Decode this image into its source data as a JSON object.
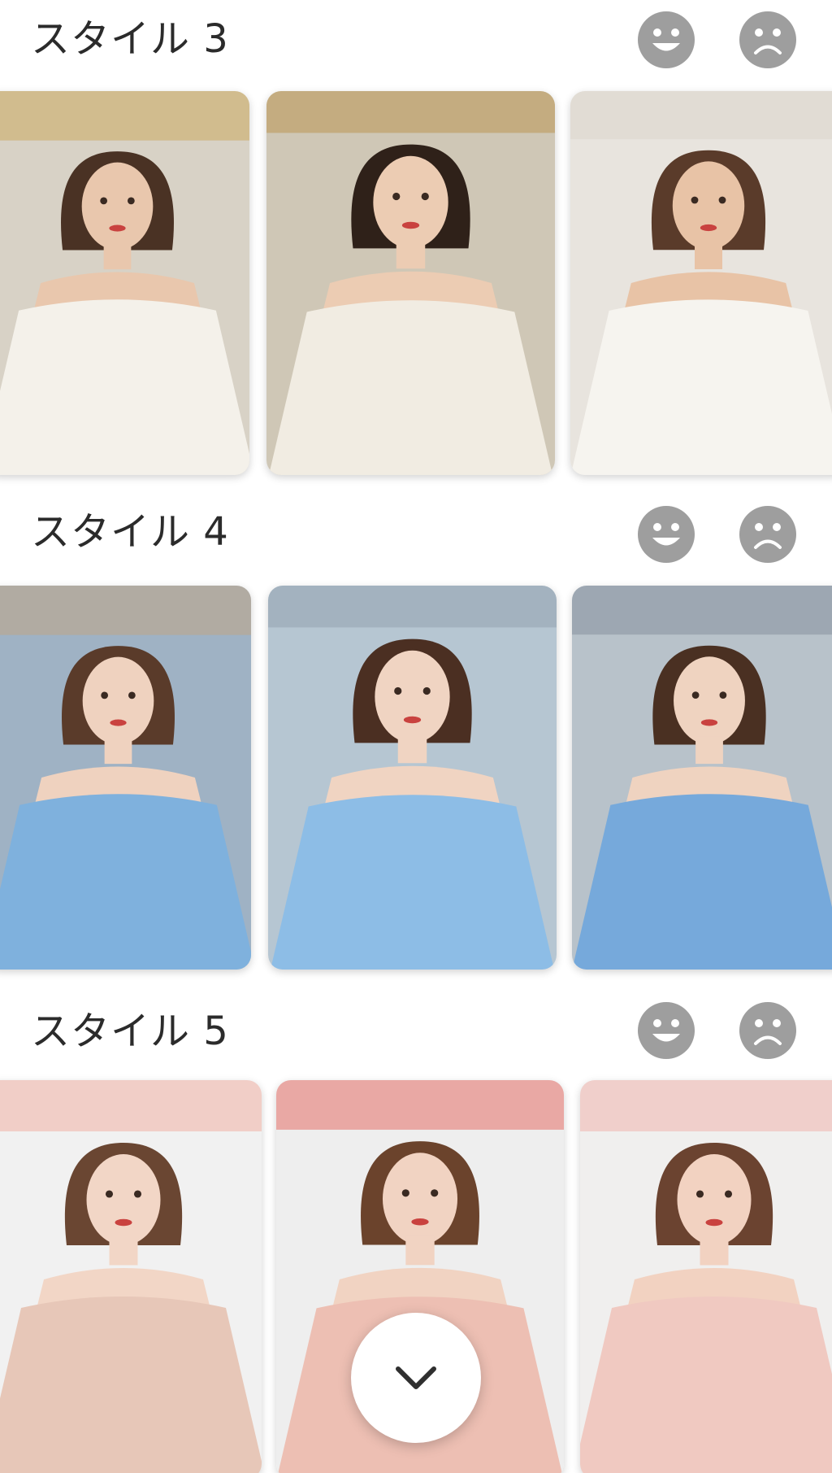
{
  "sections": [
    {
      "title": "スタイル 3",
      "photos": [
        {
          "alt": "white-gown-portrait-1",
          "palette": {
            "bg": "#d8d2c6",
            "accent": "#c9a24a",
            "dress": "#f4f1ea",
            "skin": "#e9c7ad",
            "hair": "#4a3224"
          }
        },
        {
          "alt": "white-gown-portrait-2",
          "palette": {
            "bg": "#cfc7b6",
            "accent": "#b58c3d",
            "dress": "#f1ece2",
            "skin": "#ecccb3",
            "hair": "#2f2119"
          }
        },
        {
          "alt": "white-gown-portrait-3",
          "palette": {
            "bg": "#e8e4de",
            "accent": "#d9d2c8",
            "dress": "#f6f4ef",
            "skin": "#e8c3a6",
            "hair": "#5a3b2a"
          }
        }
      ]
    },
    {
      "title": "スタイル 4",
      "photos": [
        {
          "alt": "blue-gown-portrait-1",
          "palette": {
            "bg": "#9fb2c4",
            "accent": "#c7a27a",
            "dress": "#7fb1dd",
            "skin": "#efd2bf",
            "hair": "#5a3b2a"
          }
        },
        {
          "alt": "blue-gown-portrait-2",
          "palette": {
            "bg": "#b6c6d2",
            "accent": "#8c9aa8",
            "dress": "#8dbde6",
            "skin": "#f0d4c2",
            "hair": "#4b2f22"
          }
        },
        {
          "alt": "blue-gown-portrait-3",
          "palette": {
            "bg": "#b8c2ca",
            "accent": "#7c8894",
            "dress": "#76a9db",
            "skin": "#efd3c0",
            "hair": "#4a3022"
          }
        }
      ]
    },
    {
      "title": "スタイル 5",
      "photos": [
        {
          "alt": "pink-gown-portrait-1",
          "palette": {
            "bg": "#f1f1f1",
            "accent": "#f2a494",
            "dress": "#e7c7b8",
            "skin": "#f2d6c6",
            "hair": "#6a4632"
          }
        },
        {
          "alt": "pink-gown-portrait-2",
          "palette": {
            "bg": "#eeeeee",
            "accent": "#e2514a",
            "dress": "#edbfb3",
            "skin": "#f1d3c2",
            "hair": "#6b432c"
          }
        },
        {
          "alt": "pink-gown-portrait-3",
          "palette": {
            "bg": "#f0efee",
            "accent": "#f0a9a0",
            "dress": "#f0c9c1",
            "skin": "#f2d2c1",
            "hair": "#6b4330"
          }
        }
      ]
    }
  ],
  "icons": {
    "like": "smiling-face-icon",
    "dislike": "frowning-face-icon",
    "scroll": "chevron-down-icon"
  },
  "colors": {
    "icon_gray": "#9e9e9e",
    "title_text": "#2b2b2b",
    "background": "#ffffff"
  }
}
